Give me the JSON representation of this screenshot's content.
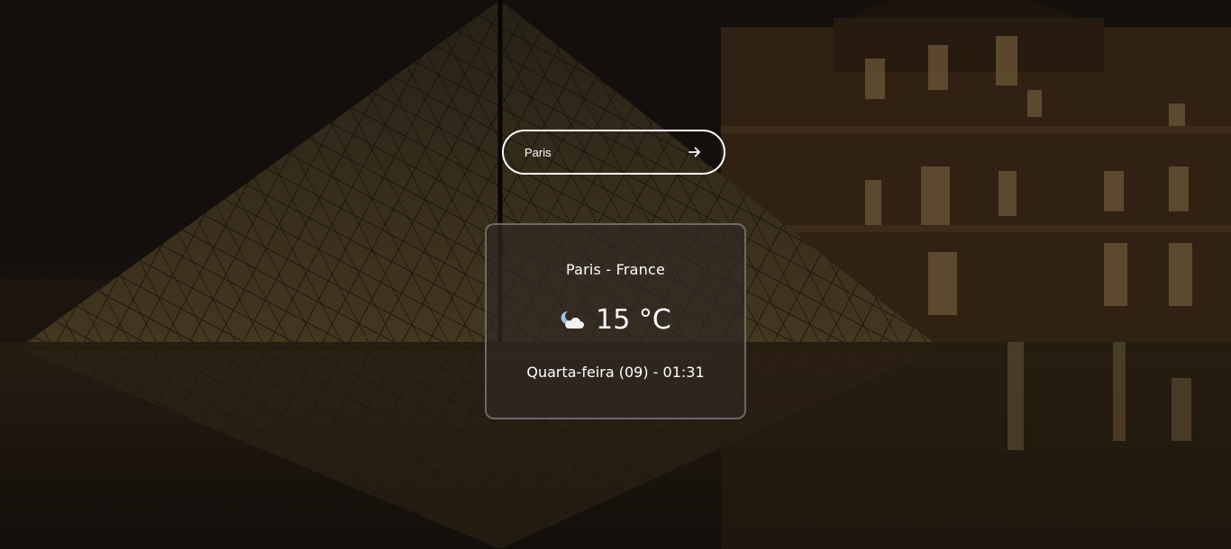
{
  "search": {
    "value": "Paris",
    "submit_icon": "arrow-right-icon"
  },
  "weather": {
    "location": "Paris - France",
    "icon": "partly-cloudy-night-icon",
    "temperature": "15 °C",
    "datetime": "Quarta-feira (09) - 01:31"
  },
  "background": {
    "description_icon": "louvre-pyramid-night-photo",
    "overlay_color": "#000000"
  }
}
